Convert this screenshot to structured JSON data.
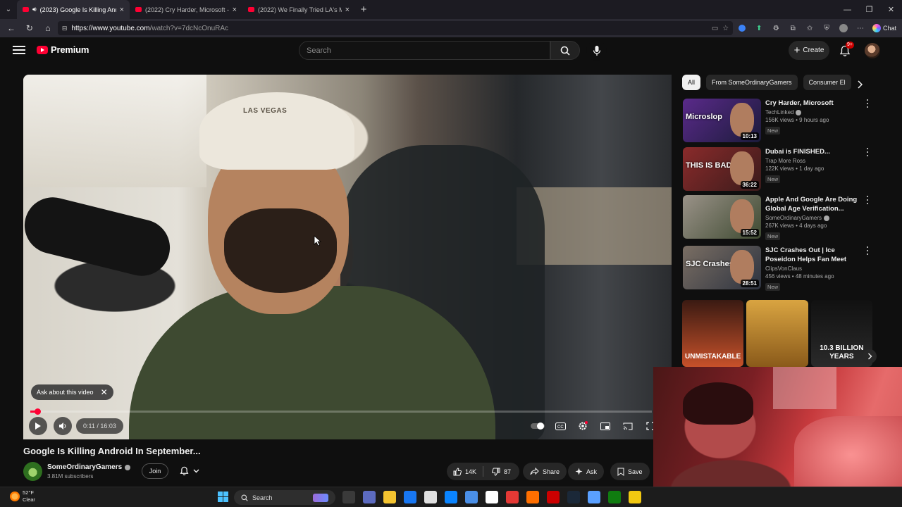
{
  "browser": {
    "tabs": [
      {
        "label": "(2023) Google Is Killing Andro",
        "active": true,
        "audio": true
      },
      {
        "label": "(2022) Cry Harder, Microsoft - Yo",
        "active": false
      },
      {
        "label": "(2022) We Finally Tried LA's Most",
        "active": false
      }
    ],
    "url_host": "https://www.youtube.com",
    "url_rest": "/watch?v=7dcNcOnuRAc",
    "chat_label": "Chat"
  },
  "masthead": {
    "logo_text": "Premium",
    "search_placeholder": "Search",
    "create_label": "Create",
    "notifications_badge": "9+"
  },
  "player": {
    "cap_text": "LAS VEGAS",
    "ask_chip_label": "Ask about this video",
    "time": "0:11 / 16:03",
    "progress_fraction": 0.0114
  },
  "video": {
    "title": "Google Is Killing Android In September...",
    "channel": "SomeOrdinaryGamers",
    "subscribers": "3.81M subscribers",
    "join_label": "Join",
    "likes": "14K",
    "dislikes": "87",
    "share_label": "Share",
    "ask_label": "Ask",
    "save_label": "Save"
  },
  "sidebar": {
    "chips": [
      "All",
      "From SomeOrdinaryGamers",
      "Consumer El"
    ],
    "recommendations": [
      {
        "title": "Cry Harder, Microsoft",
        "channel": "TechLinked",
        "verified": true,
        "stats": "156K views • 9 hours ago",
        "badge": "New",
        "duration": "10:13",
        "thumb_text": "Microslop",
        "thumb_colors": [
          "#5a2a8a",
          "#1b1b3a"
        ]
      },
      {
        "title": "Dubai is FINISHED...",
        "channel": "Trap More Ross",
        "verified": false,
        "stats": "122K views • 1 day ago",
        "badge": "New",
        "duration": "36:22",
        "thumb_text": "THIS IS BAD",
        "thumb_colors": [
          "#8a2b2b",
          "#3a1b1b"
        ]
      },
      {
        "title": "Apple And Google Are Doing Global Age Verification...",
        "channel": "SomeOrdinaryGamers",
        "verified": true,
        "stats": "267K views • 4 days ago",
        "badge": "New",
        "duration": "15:52",
        "thumb_text": "",
        "thumb_colors": [
          "#9a9288",
          "#3e4a31"
        ]
      },
      {
        "title": "SJC Crashes Out | Ice Poseidon Helps Fan Meet Amouranth",
        "channel": "ClipsVonClaus",
        "verified": false,
        "stats": "456 views • 48 minutes ago",
        "badge": "New",
        "duration": "28:51",
        "thumb_text": "SJC Crashes O",
        "thumb_colors": [
          "#7a6e63",
          "#2d3340"
        ]
      }
    ],
    "shorts": [
      {
        "text": "UNMISTAKABLE",
        "colors": [
          "#3a1a12",
          "#c7512a"
        ]
      },
      {
        "text": "",
        "colors": [
          "#d9a441",
          "#8a5a1a"
        ]
      },
      {
        "text": "10.3 BILLION YEARS",
        "colors": [
          "#111111",
          "#2a2a2a"
        ]
      }
    ]
  },
  "taskbar": {
    "temperature": "52°F",
    "condition": "Clear",
    "search_label": "Search",
    "app_colors": [
      "#3a3a3a",
      "#5c6bc0",
      "#f4c430",
      "#1877f2",
      "#e0e0e0",
      "#0a84ff",
      "#4a8fe7",
      "#ffffff",
      "#e53935",
      "#ff6f00",
      "#cc0000",
      "#1b2838",
      "#5aa0ff",
      "#107c10",
      "#f2c811"
    ]
  },
  "colors": {
    "accent_red": "#ff0033",
    "background": "#0f0f0f",
    "chip_active": "#f1f1f1"
  }
}
